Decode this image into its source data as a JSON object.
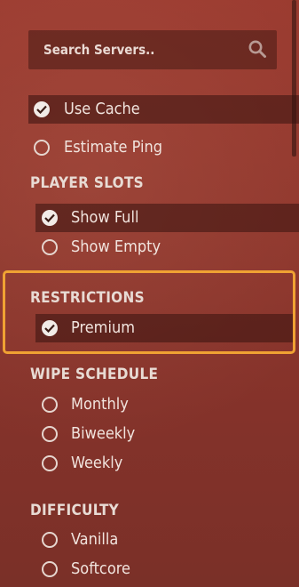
{
  "search": {
    "placeholder": "Search Servers.."
  },
  "general_options": [
    {
      "label": "Use Cache",
      "checked": true
    },
    {
      "label": "Estimate Ping",
      "checked": false
    }
  ],
  "sections": [
    {
      "title": "PLAYER SLOTS",
      "items": [
        {
          "label": "Show Full",
          "checked": true
        },
        {
          "label": "Show Empty",
          "checked": false
        }
      ]
    },
    {
      "title": "RESTRICTIONS",
      "items": [
        {
          "label": "Premium",
          "checked": true
        }
      ]
    },
    {
      "title": "WIPE SCHEDULE",
      "items": [
        {
          "label": "Monthly",
          "checked": false
        },
        {
          "label": "Biweekly",
          "checked": false
        },
        {
          "label": "Weekly",
          "checked": false
        }
      ]
    },
    {
      "title": "DIFFICULTY",
      "items": [
        {
          "label": "Vanilla",
          "checked": false
        },
        {
          "label": "Softcore",
          "checked": false
        }
      ]
    }
  ],
  "colors": {
    "highlight": "#f0a233"
  }
}
